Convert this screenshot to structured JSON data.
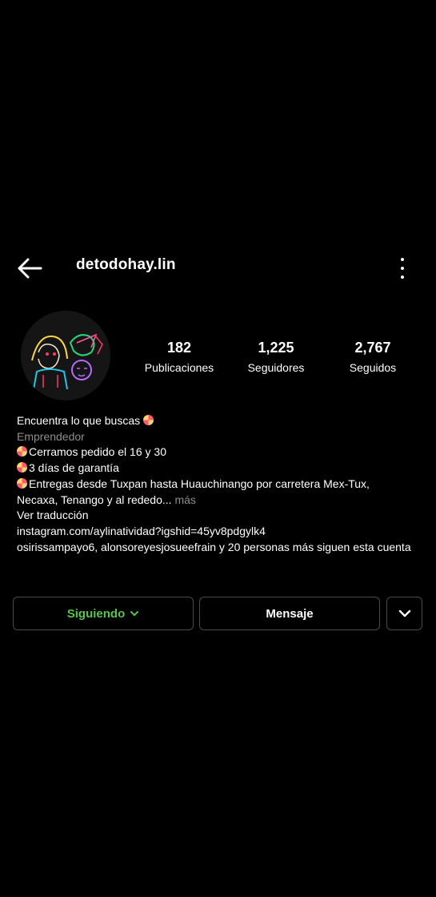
{
  "header": {
    "username": "detodohay.lin"
  },
  "stats": [
    {
      "value": "182",
      "label": "Publicaciones"
    },
    {
      "value": "1,225",
      "label": "Seguidores"
    },
    {
      "value": "2,767",
      "label": "Seguidos"
    }
  ],
  "bio": {
    "name_line": "Encuentra lo que buscas",
    "category": "Emprendedor",
    "line1": "Cerramos pedido el 16 y 30",
    "line2": "3 días de garantía",
    "line3a": "Entregas desde Tuxpan hasta Huauchinango por carretera Mex-Tux,",
    "line3b": "Necaxa, Tenango y al rededo...",
    "more": "más",
    "translate": "Ver traducción",
    "link": "instagram.com/aylinatividad?igshid=45yv8pdgylk4",
    "followed_by": "osirissampayo6, alonsoreyesjosueefrain y 20 personas más siguen esta cuenta"
  },
  "actions": {
    "following": "Siguiendo",
    "message": "Mensaje"
  },
  "colors": {
    "background": "#000000",
    "following_green": "#58c44a",
    "muted": "#8e8e8e",
    "border": "#4a4a4a"
  }
}
